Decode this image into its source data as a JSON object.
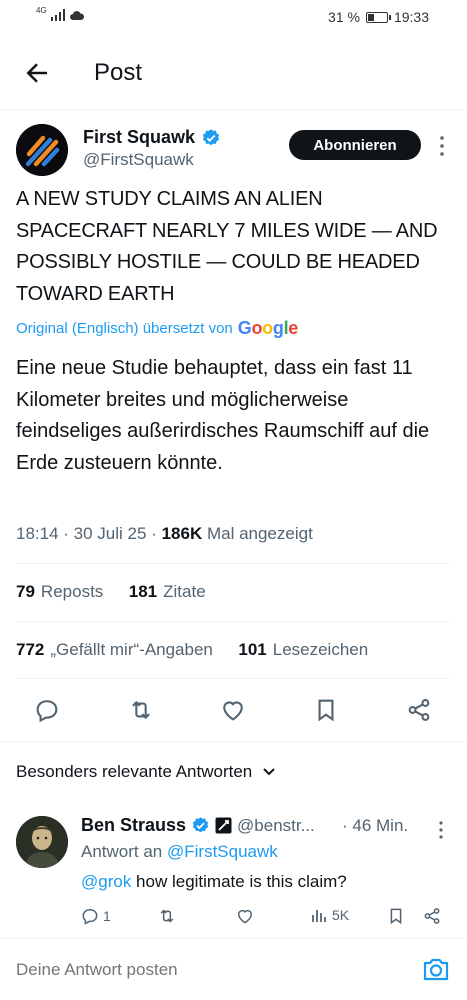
{
  "status_bar": {
    "network": "4G",
    "battery_percent": "31 %",
    "battery_level": 0.31,
    "time": "19:33"
  },
  "header": {
    "title": "Post"
  },
  "author": {
    "name": "First Squawk",
    "handle": "@FirstSquawk",
    "follow_label": "Abonnieren"
  },
  "tweet": {
    "text": "A NEW STUDY CLAIMS AN ALIEN SPACECRAFT NEARLY 7 MILES WIDE — AND POSSIBLY HOSTILE — COULD BE HEADED TOWARD EARTH",
    "translated_by": "Original (Englisch) übersetzt von",
    "google": "Google",
    "translation": "Eine neue Studie behauptet, dass ein fast 11 Kilometer breites und möglicherweise feindseliges außerirdisches Raumschiff auf die Erde zusteuern könnte.",
    "time": "18:14",
    "date": "30 Juli 25",
    "views_count": "186K",
    "views_label": "Mal angezeigt"
  },
  "stats": {
    "reposts_count": "79",
    "reposts_label": "Reposts",
    "quotes_count": "181",
    "quotes_label": "Zitate",
    "likes_count": "772",
    "likes_label": "„Gefällt mir“-Angaben",
    "bookmarks_count": "101",
    "bookmarks_label": "Lesezeichen"
  },
  "replies_section": {
    "title": "Besonders relevante Antworten"
  },
  "reply": {
    "name": "Ben Strauss",
    "handle": "@benstr...",
    "time": "· 46 Min.",
    "reply_to_prefix": "Antwort an",
    "reply_to_handle": "@FirstSquawk",
    "mention": "@grok",
    "text": " how legitimate is this claim?",
    "reply_count": "1",
    "views": "5K"
  },
  "composer": {
    "placeholder": "Deine Antwort posten"
  },
  "colors": {
    "accent": "#1d9bf0",
    "verified": "#1d9bf0",
    "text": "#0f1419",
    "muted": "#536471"
  }
}
